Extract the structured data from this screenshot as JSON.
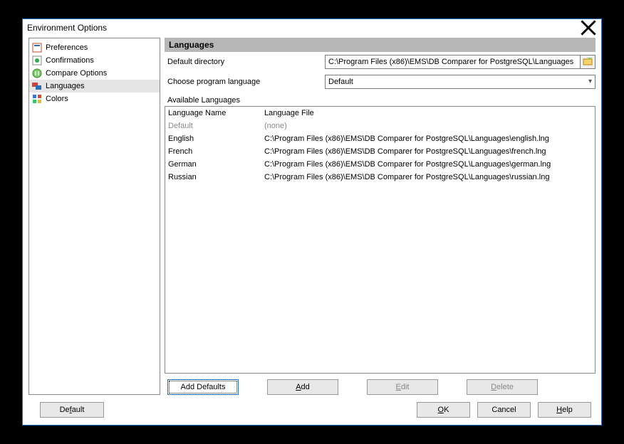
{
  "title": "Environment Options",
  "nav": [
    {
      "label": "Preferences"
    },
    {
      "label": "Confirmations"
    },
    {
      "label": "Compare Options"
    },
    {
      "label": "Languages"
    },
    {
      "label": "Colors"
    }
  ],
  "section": "Languages",
  "default_dir": {
    "label": "Default directory",
    "value": "C:\\Program Files (x86)\\EMS\\DB Comparer for PostgreSQL\\Languages"
  },
  "choose_lang": {
    "label": "Choose program language",
    "value": "Default"
  },
  "avail_label": "Available Languages",
  "columns": {
    "c1": "Language Name",
    "c2": "Language File"
  },
  "rows": [
    {
      "name": "Default",
      "file": "(none)",
      "dim": true
    },
    {
      "name": "English",
      "file": "C:\\Program Files (x86)\\EMS\\DB Comparer for PostgreSQL\\Languages\\english.lng"
    },
    {
      "name": "French",
      "file": "C:\\Program Files (x86)\\EMS\\DB Comparer for PostgreSQL\\Languages\\french.lng"
    },
    {
      "name": "German",
      "file": "C:\\Program Files (x86)\\EMS\\DB Comparer for PostgreSQL\\Languages\\german.lng"
    },
    {
      "name": "Russian",
      "file": "C:\\Program Files (x86)\\EMS\\DB Comparer for PostgreSQL\\Languages\\russian.lng"
    }
  ],
  "buttons": {
    "addDefaults": "Add Defaults",
    "add": "Add",
    "edit": "Edit",
    "delete": "Delete"
  },
  "footer": {
    "default": "Default",
    "ok": "OK",
    "cancel": "Cancel",
    "help": "Help"
  }
}
